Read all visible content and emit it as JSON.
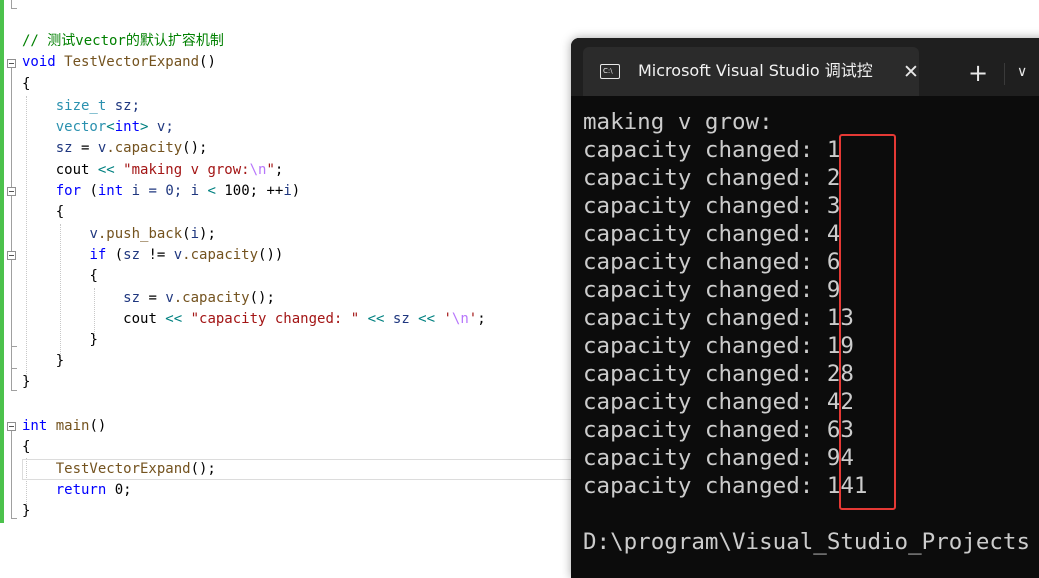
{
  "editor": {
    "comment": "// 测试vector的默认扩容机制",
    "func_ret": "void",
    "func_name": "TestVectorExpand",
    "func_parens": "()",
    "brace_open": "{",
    "brace_close": "}",
    "l_size_t": "size_t",
    "l_sz_decl": " sz;",
    "l_vector": "vector",
    "l_lt": "<",
    "l_int": "int",
    "l_gt": ">",
    "l_v_decl": " v;",
    "l_sz": "sz",
    "l_assign": " = ",
    "l_v": "v",
    "l_capacity_call": ".capacity",
    "l_call_end": "();",
    "l_cout": "cout",
    "l_shl": " << ",
    "s_making": "\"making v grow:",
    "s_nl_esc": "\\n",
    "s_quote_end": "\"",
    "semicolon": ";",
    "kw_for": "for",
    "for_open": " (",
    "for_int": "int",
    "for_i_init": " i = 0; ",
    "for_i": "i",
    "for_lt": " < ",
    "for_limit": "100",
    "for_inc": "; ++",
    "for_i2": "i",
    "for_close": ")",
    "push_back": ".push_back",
    "push_args_open": "(",
    "push_i": "i",
    "push_end": ");",
    "kw_if": "if",
    "if_open": " (",
    "if_sz": "sz",
    "if_ne": " != ",
    "if_v": "v",
    "if_cap": ".capacity",
    "if_close": "())",
    "s_cap_changed": "\"capacity changed: \"",
    "l_sz2": "sz",
    "c_quote": "'",
    "c_nl_esc": "\\n",
    "main_ret": "int",
    "main_name": "main",
    "main_parens": "()",
    "call_name": "TestVectorExpand",
    "call_end": "();",
    "kw_return": "return",
    "return_val": " 0;"
  },
  "terminal": {
    "icon_label": "C:\\",
    "tab_title": "Microsoft Visual Studio 调试控",
    "close_glyph": "✕",
    "new_tab_glyph": "+",
    "dropdown_glyph": "∨",
    "header_line": "making v grow:",
    "line_prefix": "capacity changed: ",
    "capacity_values": [
      "1",
      "2",
      "3",
      "4",
      "6",
      "9",
      "13",
      "19",
      "28",
      "42",
      "63",
      "94",
      "141"
    ],
    "path_line": "D:\\program\\Visual_Studio_Projects",
    "highlight_color": "#e53935"
  }
}
